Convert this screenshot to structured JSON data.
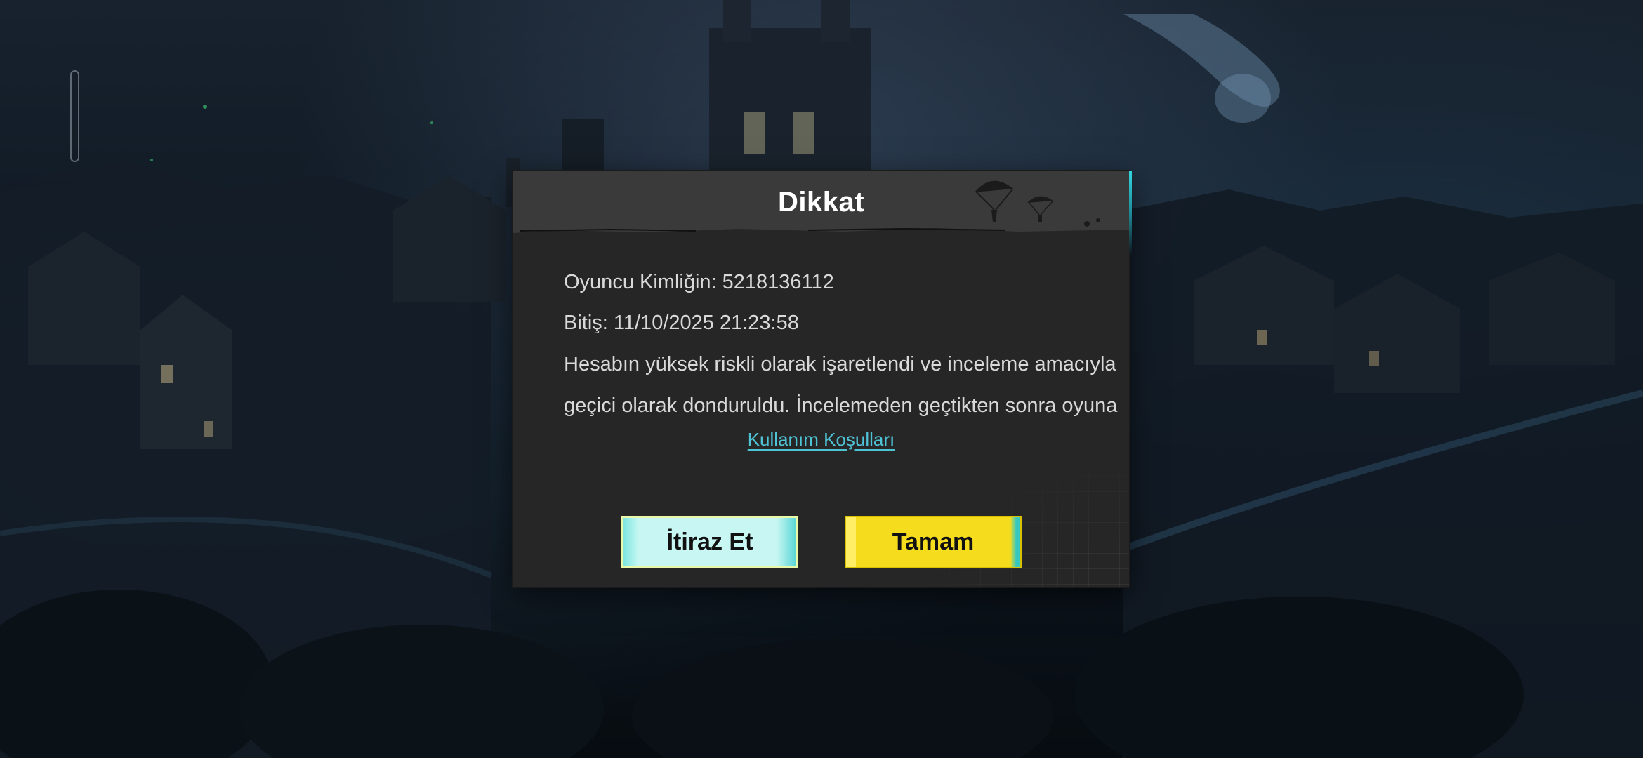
{
  "dialog": {
    "title": "Dikkat",
    "player_id_line": "Oyuncu Kimliğin: 5218136112",
    "expiry_line": "Bitiş: 11/10/2025 21:23:58",
    "message_line_1": "Hesabın yüksek riskli olarak işaretlendi ve inceleme amacıyla",
    "message_line_2": "geçici olarak donduruldu. İncelemeden geçtikten sonra oyuna",
    "terms_link": "Kullanım Koşulları",
    "appeal_button": "İtiraz Et",
    "ok_button": "Tamam"
  },
  "colors": {
    "accent_link": "#4fc3d6",
    "appeal_button_bg": "#c8f7f3",
    "ok_button_bg": "#f5dd1e",
    "dialog_bg": "#262626",
    "header_bg": "#3a3a3a"
  },
  "icons": {
    "header_decoration": "parachute-icon",
    "side_handle": "side-handle"
  }
}
